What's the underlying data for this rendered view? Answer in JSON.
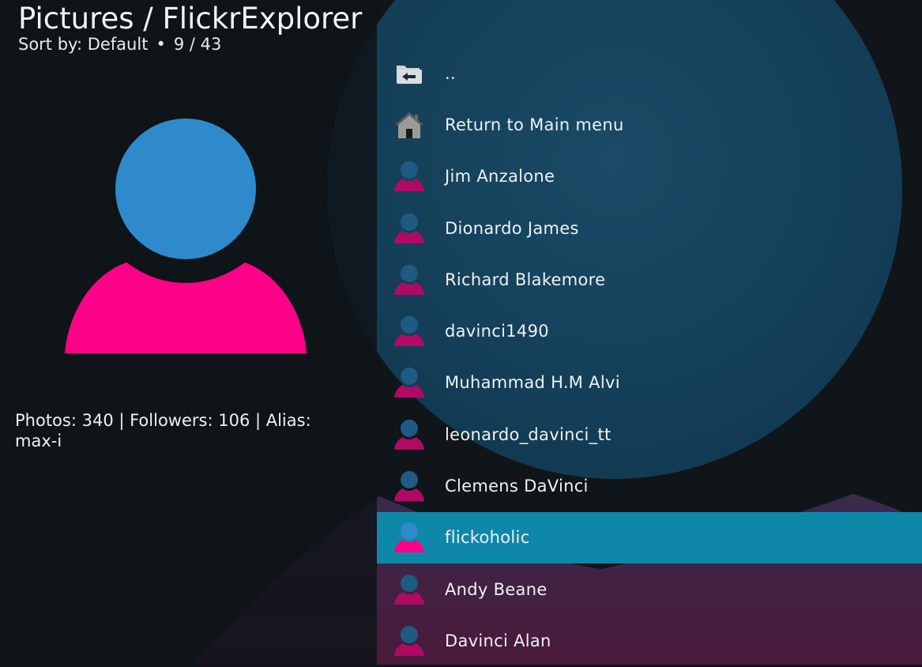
{
  "header": {
    "title": "Pictures / FlickrExplorer",
    "sort_label": "Sort by: Default",
    "separator": "•",
    "position": "9 / 43"
  },
  "preview": {
    "icon": "user-avatar-icon",
    "colors": {
      "head": "#2f8acb",
      "body": "#ff0088"
    }
  },
  "info": {
    "text": "Photos: 340 | Followers: 106 | Alias: max-i"
  },
  "list": {
    "selected_index": 9,
    "selected_color": "#0f87a9",
    "items": [
      {
        "label": "..",
        "icon": "folder-back-icon"
      },
      {
        "label": "Return to Main menu",
        "icon": "home-icon"
      },
      {
        "label": "Jim Anzalone",
        "icon": "user-icon"
      },
      {
        "label": "Dionardo James",
        "icon": "user-icon"
      },
      {
        "label": "Richard Blakemore",
        "icon": "user-icon"
      },
      {
        "label": "davinci1490",
        "icon": "user-icon"
      },
      {
        "label": "Muhammad H.M Alvi",
        "icon": "user-icon"
      },
      {
        "label": "leonardo_davinci_tt",
        "icon": "user-icon"
      },
      {
        "label": "Clemens DaVinci",
        "icon": "user-icon"
      },
      {
        "label": "flickoholic",
        "icon": "user-icon"
      },
      {
        "label": "Andy Beane",
        "icon": "user-icon"
      },
      {
        "label": "Davinci Alan",
        "icon": "user-icon"
      }
    ]
  }
}
